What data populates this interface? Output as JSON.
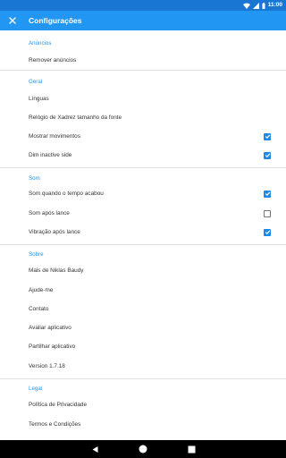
{
  "status_bar": {
    "time": "11:00"
  },
  "app_bar": {
    "title": "Configurações",
    "close_icon": "close-icon"
  },
  "sections": {
    "ads": {
      "header": "Anúncios",
      "items": [
        {
          "label": "Remover anúncios"
        }
      ]
    },
    "general": {
      "header": "Geral",
      "items": [
        {
          "label": "Línguas"
        },
        {
          "label": "Relógio de Xadrez tamanho da fonte"
        },
        {
          "label": "Mostrar movimentos",
          "checked": true
        },
        {
          "label": "Dim inactive side",
          "checked": true
        }
      ]
    },
    "sound": {
      "header": "Som",
      "items": [
        {
          "label": "Som quando o tempo acabou",
          "checked": true
        },
        {
          "label": "Som após lance",
          "checked": false
        },
        {
          "label": "Vibração após lance",
          "checked": true
        }
      ]
    },
    "about": {
      "header": "Sobre",
      "items": [
        {
          "label": "Mais de Niklas Baudy"
        },
        {
          "label": "Ajude-me"
        },
        {
          "label": "Contato"
        },
        {
          "label": "Avaliar aplicativo"
        },
        {
          "label": "Partilhar aplicativo"
        },
        {
          "label": "Version 1.7.18"
        }
      ]
    },
    "legal": {
      "header": "Legal",
      "items": [
        {
          "label": "Política de Privacidade"
        },
        {
          "label": "Termos e Condições"
        }
      ]
    }
  },
  "colors": {
    "primary": "#2196f3",
    "primary_dark": "#1976d2",
    "checkbox": "#1e88e5"
  }
}
